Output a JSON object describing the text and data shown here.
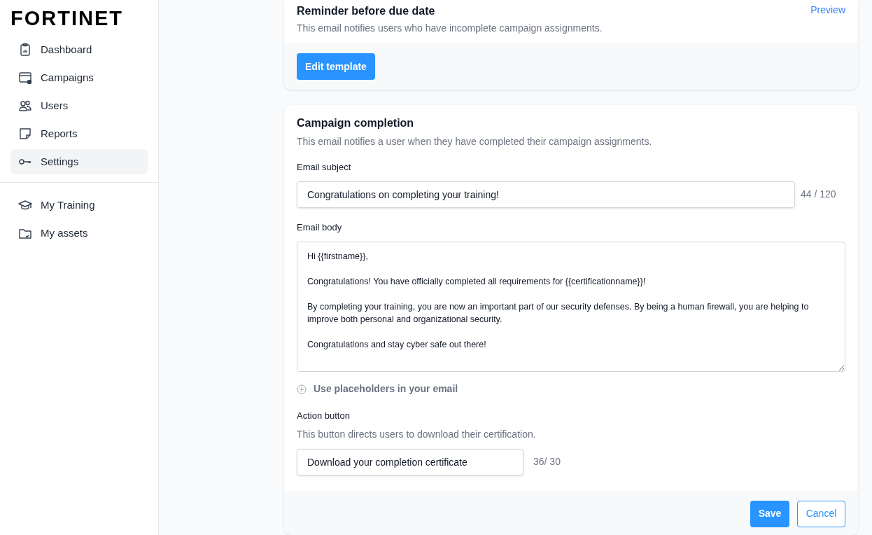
{
  "logo": "FORTINET",
  "sidebar": {
    "items": [
      {
        "label": "Dashboard",
        "selected": false
      },
      {
        "label": "Campaigns",
        "selected": false
      },
      {
        "label": "Users",
        "selected": false
      },
      {
        "label": "Reports",
        "selected": false
      },
      {
        "label": "Settings",
        "selected": true
      }
    ],
    "secondary_items": [
      {
        "label": "My Training",
        "selected": false
      },
      {
        "label": "My assets",
        "selected": false
      }
    ]
  },
  "reminder_card": {
    "title": "Reminder before due date",
    "description": "This email notifies users who have incomplete campaign assignments.",
    "preview_link": "Preview",
    "edit_button": "Edit template"
  },
  "completion_card": {
    "title": "Campaign completion",
    "description": "This email notifies a user when they have completed their campaign assignments.",
    "subject": {
      "label": "Email subject",
      "value": "Congratulations on completing your training!",
      "counter": "44 / 120"
    },
    "body": {
      "label": "Email body",
      "value": "Hi {{firstname}},\n\nCongratulations! You have officially completed all requirements for {{certificationname}}!\n\nBy completing your training, you are now an important part of our security defenses. By being a human firewall, you are helping to improve both personal and organizational security.\n\nCongratulations and stay cyber safe out there!"
    },
    "placeholders_toggle": {
      "label": "Use placeholders in your email",
      "expanded": false
    },
    "action_button": {
      "label": "Action button",
      "description": "This button directs users to download their certification.",
      "value": "Download your completion certificate",
      "counter": "36/ 30"
    },
    "save_button": "Save",
    "cancel_button": "Cancel"
  }
}
